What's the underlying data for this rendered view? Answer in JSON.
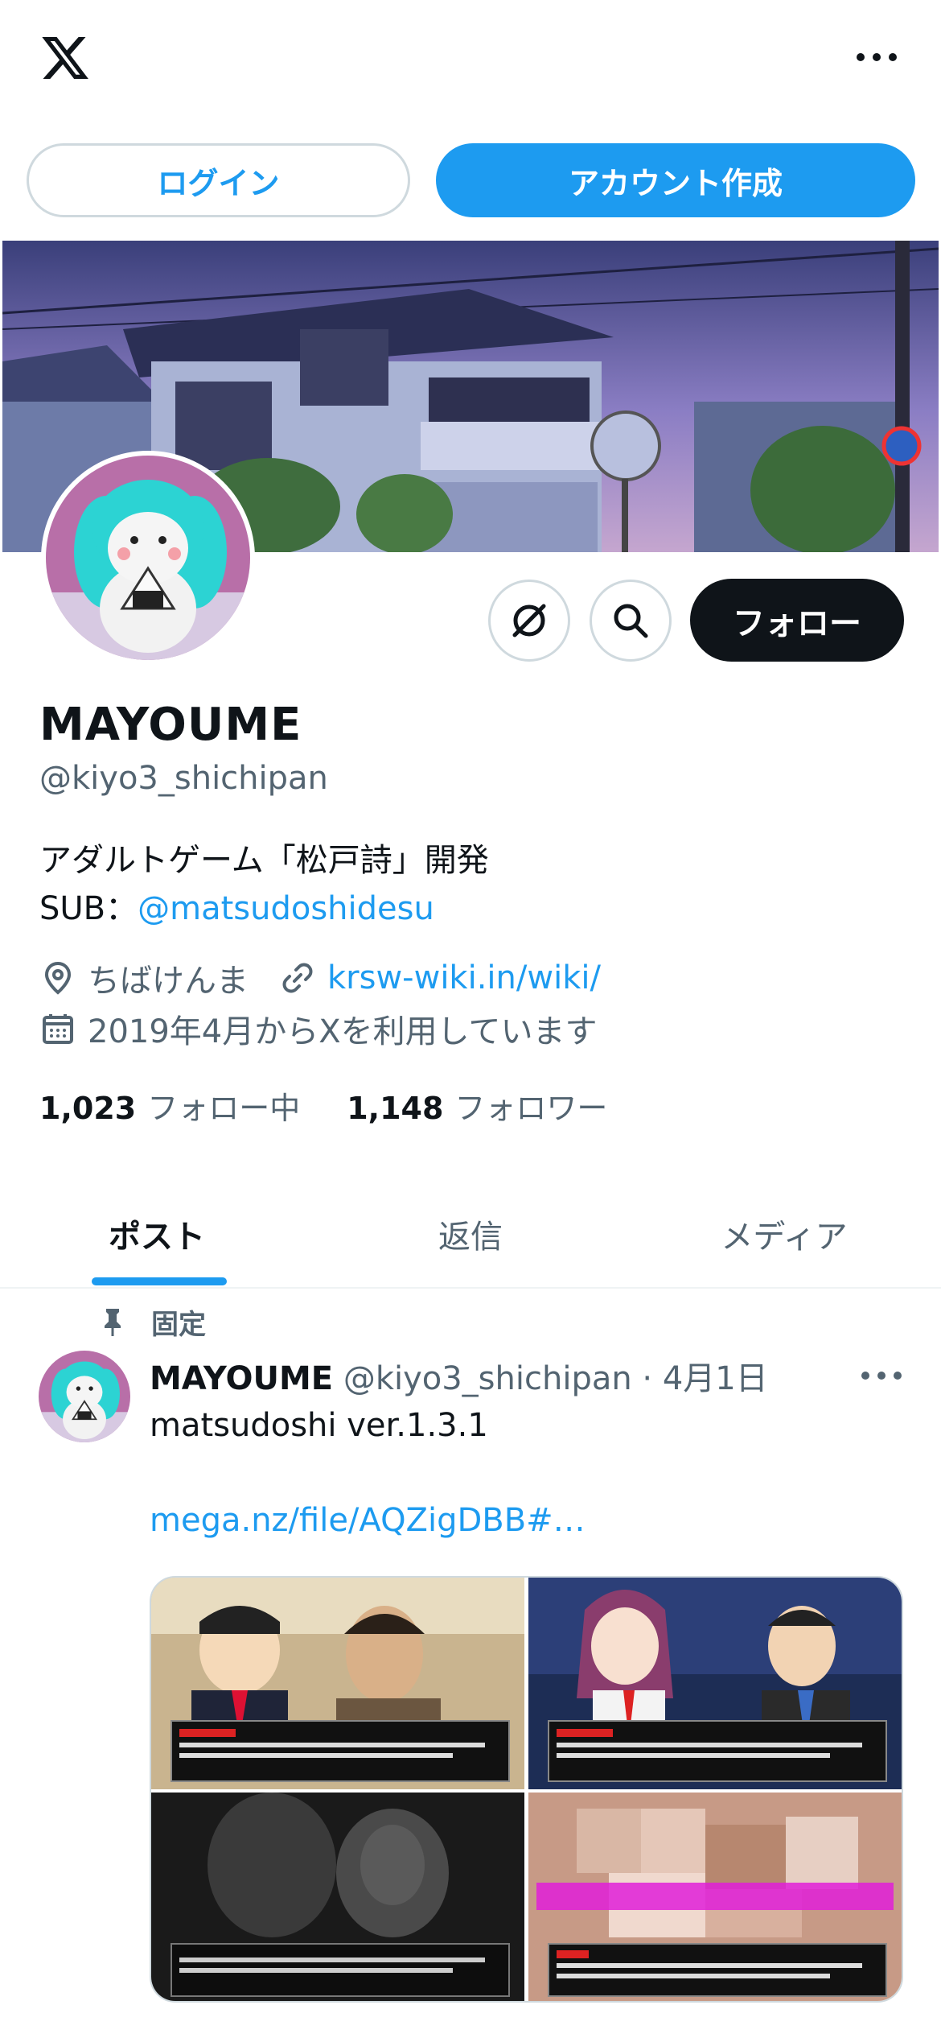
{
  "header": {
    "logo_icon": "x-logo-icon",
    "more_icon": "more-horizontal-icon"
  },
  "auth": {
    "login_label": "ログイン",
    "signup_label": "アカウント作成"
  },
  "profile": {
    "display_name": "MAYOUME",
    "handle": "@kiyo3_shichipan",
    "bio_line1": "アダルトゲーム「松戸詩」開発",
    "bio_line2_prefix": "SUB：",
    "bio_line2_mention": "@matsudoshidesu",
    "location": "ちばけんま",
    "website": "krsw-wiki.in/wiki/",
    "joined": "2019年4月からXを利用しています",
    "following_count": "1,023",
    "following_label": "フォロー中",
    "followers_count": "1,148",
    "followers_label": "フォロワー",
    "follow_button": "フォロー"
  },
  "tabs": [
    {
      "label": "ポスト",
      "active": true
    },
    {
      "label": "返信",
      "active": false
    },
    {
      "label": "メディア",
      "active": false
    }
  ],
  "post": {
    "pinned_label": "固定",
    "author_name": "MAYOUME",
    "author_handle": "@kiyo3_shichipan",
    "separator": " · ",
    "date": "4月1日",
    "text": "matsudoshi ver.1.3.1",
    "link": "mega.nz/file/AQZigDBB#…"
  },
  "colors": {
    "accent": "#1d9bf0",
    "text_primary": "#0f1419",
    "text_secondary": "#536471",
    "border": "#cfd9de"
  }
}
